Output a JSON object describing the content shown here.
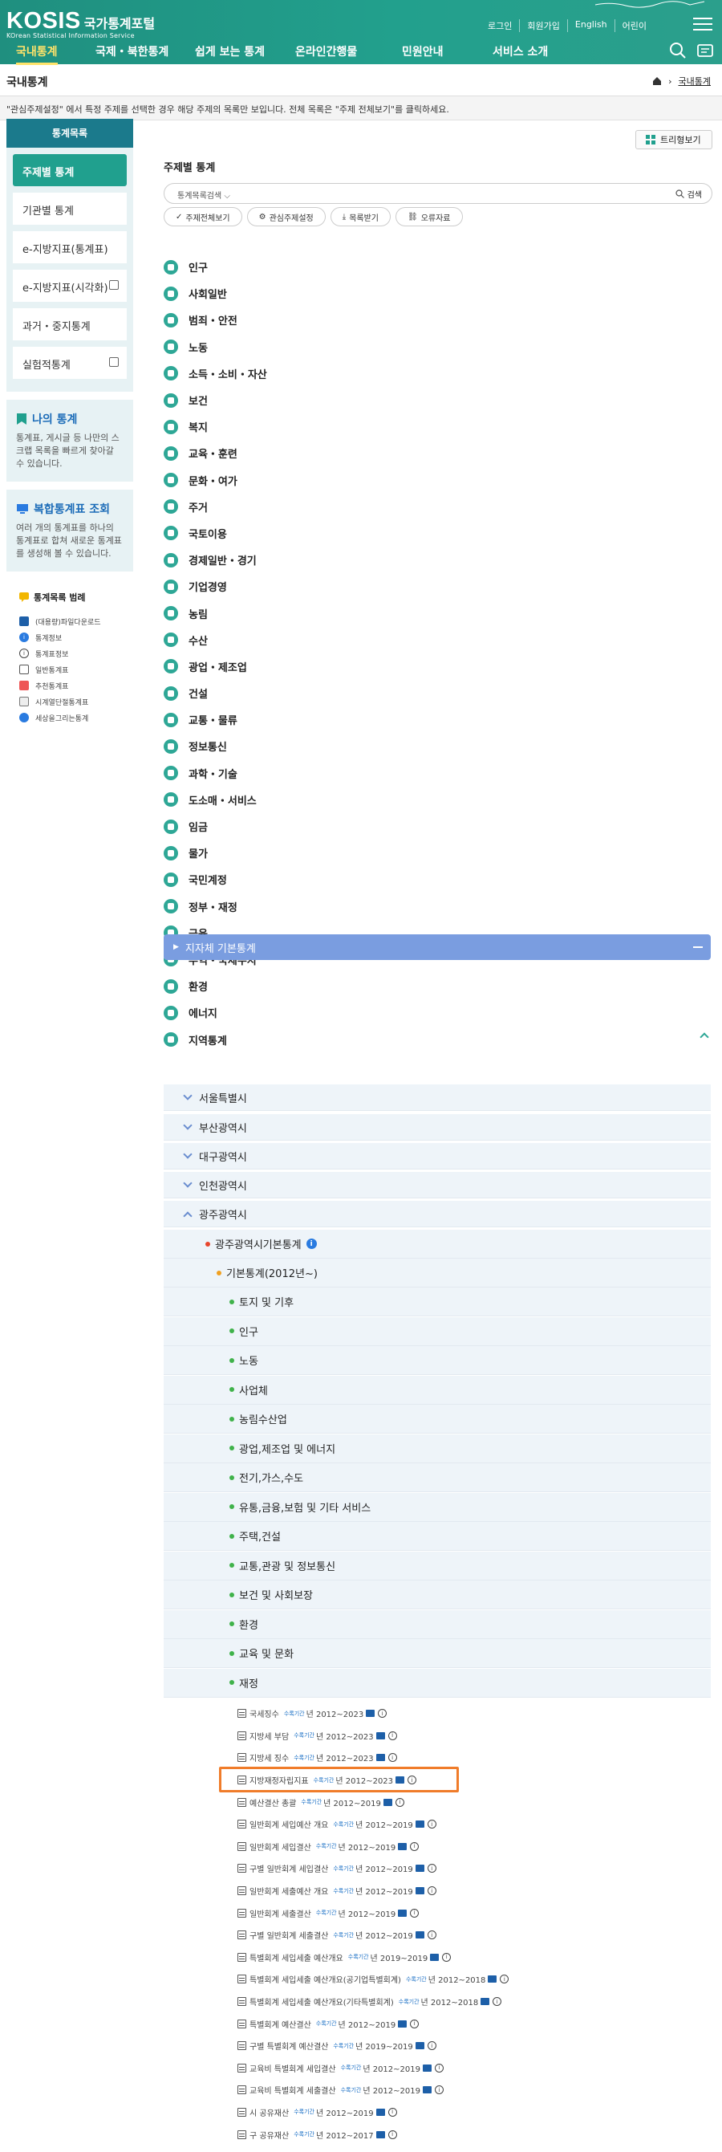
{
  "header": {
    "logo_main": "KOSIS",
    "logo_kr": "국가통계포털",
    "logo_sub": "KOrean Statistical Information Service",
    "top_links": [
      "로그인",
      "회원가입",
      "English",
      "어린이"
    ],
    "gnb": [
      "국내통계",
      "국제・북한통계",
      "쉽게 보는 통계",
      "온라인간행물",
      "민원안내",
      "서비스 소개"
    ]
  },
  "location": {
    "title": "국내통계",
    "crumb": "국내통계",
    "notice": "\"관심주제설정\" 에서 특정 주제를 선택한 경우 해당 주제의 목록만 보입니다. 전체 목록은 \"주제 전체보기\"를 클릭하세요."
  },
  "sidebar": {
    "head": "통계목록",
    "items": [
      "주제별 통계",
      "기관별 통계",
      "e-지방지표(통계표)",
      "e-지방지표(시각화)",
      "과거・중지통계",
      "실험적통계"
    ],
    "my_title": "나의 통계",
    "my_desc": "통계표, 게시글 등 나만의 스크랩 목록을 빠르게 찾아갈 수 있습니다.",
    "complex_title": "복합통계표 조회",
    "complex_desc": "여러 개의 통계표를 하나의 통계표로 합쳐 새로운 통계표를 생성해 볼 수 있습니다.",
    "legend_title": "통계목록 범례",
    "legend": [
      "(대용량)파일다운로드",
      "통계정보",
      "통계표정보",
      "일반통계표",
      "추천통계표",
      "시계열단절통계표",
      "세상을그리는통계"
    ]
  },
  "main": {
    "title": "주제별 통계",
    "tree_btn": "트리형보기",
    "search_select": "통계목록검색",
    "search_btn": "검색",
    "buttons": [
      "주제전체보기",
      "관심주제설정",
      "목록받기",
      "오류자료"
    ],
    "categories": [
      "인구",
      "사회일반",
      "범죄・안전",
      "노동",
      "소득・소비・자산",
      "보건",
      "복지",
      "교육・훈련",
      "문화・여가",
      "주거",
      "국토이용",
      "경제일반・경기",
      "기업경영",
      "농림",
      "수산",
      "광업・제조업",
      "건설",
      "교통・물류",
      "정보통신",
      "과학・기술",
      "도소매・서비스",
      "임금",
      "물가",
      "국민계정",
      "정부・재정",
      "금융",
      "무역・국제수지",
      "환경",
      "에너지",
      "지역통계"
    ],
    "group": "지자체 기본통계",
    "regions": [
      "서울특별시",
      "부산광역시",
      "대구광역시",
      "인천광역시",
      "광주광역시"
    ],
    "gwangju_stat": "광주광역시기본통계",
    "basic": "기본통계(2012년~)",
    "subjects": [
      "토지 및 기후",
      "인구",
      "노동",
      "사업체",
      "농림수산업",
      "광업,제조업 및 에너지",
      "전기,가스,수도",
      "유통,금융,보험 및 기타 서비스",
      "주택,건설",
      "교통,관광 및 정보통신",
      "보건 및 사회보장",
      "환경",
      "교육 및 문화",
      "재정"
    ],
    "period_label": "수록기간",
    "leaves": [
      {
        "name": "국세징수",
        "years": "년 2012~2023"
      },
      {
        "name": "지방세 부담",
        "years": "년 2012~2023"
      },
      {
        "name": "지방세 징수",
        "years": "년 2012~2023"
      },
      {
        "name": "지방재정자립지표",
        "years": "년 2012~2023"
      },
      {
        "name": "예산결산 총괄",
        "years": "년 2012~2019"
      },
      {
        "name": "일반회계 세입예산 개요",
        "years": "년 2012~2019"
      },
      {
        "name": "일반회계 세입결산",
        "years": "년 2012~2019"
      },
      {
        "name": "구별 일반회계 세입결산",
        "years": "년 2012~2019"
      },
      {
        "name": "일반회계 세출예산 개요",
        "years": "년 2012~2019"
      },
      {
        "name": "일반회계 세출결산",
        "years": "년 2012~2019"
      },
      {
        "name": "구별 일반회계 세출결산",
        "years": "년 2012~2019"
      },
      {
        "name": "특별회계 세입세출 예산개요",
        "years": "년 2019~2019"
      },
      {
        "name": "특별회계 세입세출 예산개요(공기업특별회계)",
        "years": "년 2012~2018"
      },
      {
        "name": "특별회계 세입세출 예산개요(기타특별회계)",
        "years": "년 2012~2018"
      },
      {
        "name": "특별회계 예산결산",
        "years": "년 2012~2019"
      },
      {
        "name": "구별 특별회계 예산결산",
        "years": "년 2019~2019"
      },
      {
        "name": "교육비 특별회계 세입결산",
        "years": "년 2012~2019"
      },
      {
        "name": "교육비 특별회계 세출결산",
        "years": "년 2012~2019"
      },
      {
        "name": "시 공유재산",
        "years": "년 2012~2019"
      },
      {
        "name": "구 공유재산",
        "years": "년 2012~2017"
      }
    ]
  }
}
